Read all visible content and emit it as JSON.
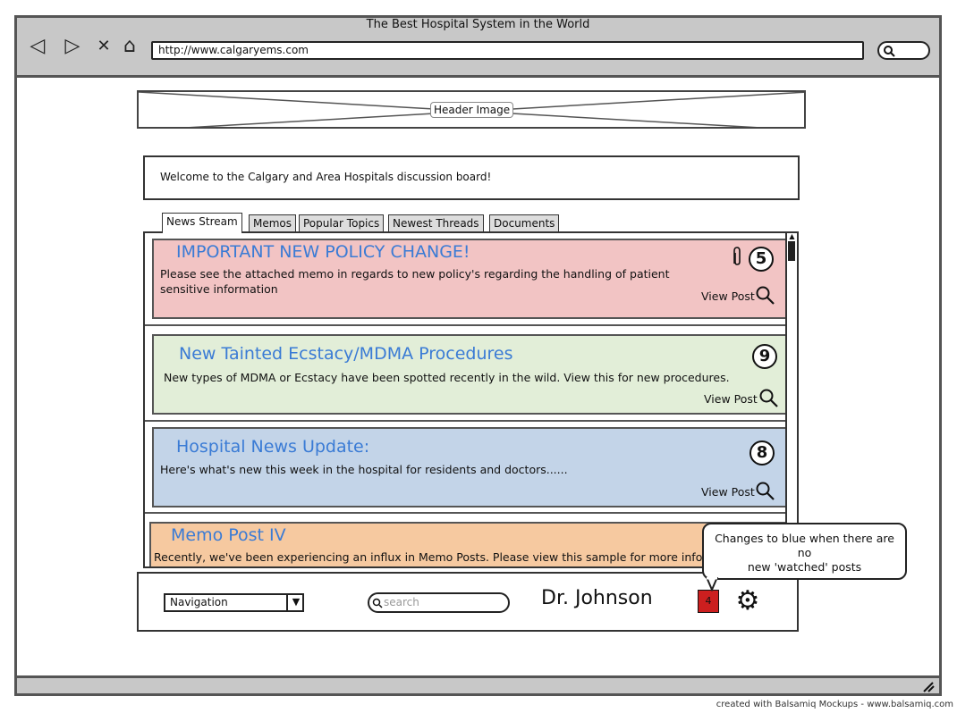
{
  "browser": {
    "title": "The Best Hospital System in the World",
    "url": "http://www.calgaryems.com",
    "nav_icons": {
      "back": "◁",
      "forward": "▷",
      "stop": "✕",
      "home": "⌂"
    }
  },
  "header_image_label": "Header Image",
  "welcome_text": "Welcome to the Calgary and Area Hospitals discussion board!",
  "tabs": [
    {
      "label": "News Stream"
    },
    {
      "label": "Memos"
    },
    {
      "label": "Popular Topics"
    },
    {
      "label": "Newest Threads"
    },
    {
      "label": "Documents"
    }
  ],
  "posts": [
    {
      "title": "IMPORTANT NEW POLICY CHANGE!",
      "body": "Please see the attached memo in regards to new policy's regarding the handling of patient sensitive information",
      "count": "5",
      "view_label": "View Post",
      "color": "#f2c4c4"
    },
    {
      "title": "New Tainted Ecstacy/MDMA Procedures",
      "body": "New types of MDMA or Ecstacy have been spotted recently in the wild. View this for new procedures.",
      "count": "9",
      "view_label": "View Post",
      "color": "#e2eed8"
    },
    {
      "title": "Hospital News Update:",
      "body": "Here's what's new this week in the hospital for residents and doctors......",
      "count": "8",
      "view_label": "View Post",
      "color": "#c3d4e8"
    },
    {
      "title": "Memo Post IV",
      "body": "Recently, we've been experiencing an influx in Memo Posts. Please view this sample for more information",
      "color": "#f6c9a0"
    }
  ],
  "footer": {
    "nav_label": "Navigation",
    "nav_arrow": "▼",
    "search_placeholder": "search",
    "username": "Dr. Johnson",
    "notification_count": "4",
    "gear_glyph": "⚙"
  },
  "tooltip": {
    "line1": "Changes to blue when there are",
    "line2": "no",
    "line3": "new 'watched' posts"
  },
  "credit": "created with Balsamiq Mockups - www.balsamiq.com"
}
